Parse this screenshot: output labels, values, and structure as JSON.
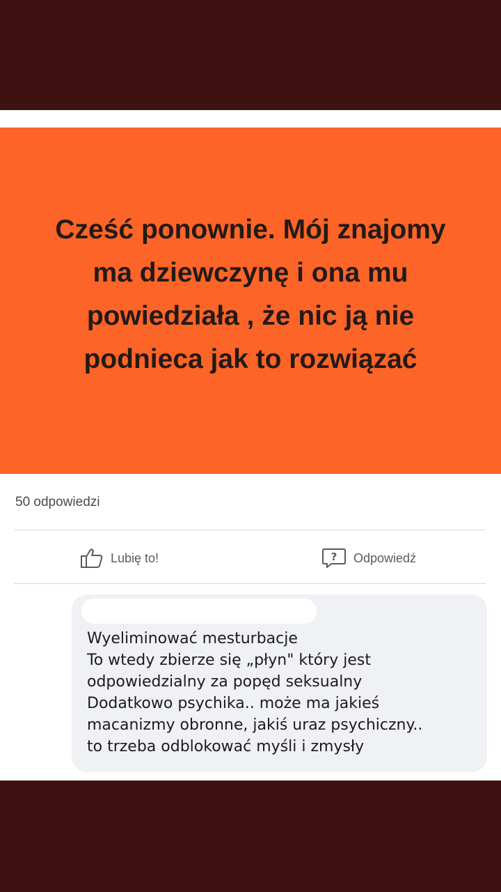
{
  "question": {
    "text": "Cześć ponownie. Mój znajomy ma dziewczynę i ona mu powiedziała , że nic ją nie podnieca jak to rozwiązać",
    "background": "#fd6427"
  },
  "answers_count": "50 odpowiedzi",
  "actions": {
    "like_label": "Lubię to!",
    "reply_label": "Odpowiedź",
    "like_icon": "thumbs-up-icon",
    "reply_icon": "question-bubble-icon"
  },
  "comment": {
    "lines": [
      "Wyeliminować mesturbacje",
      "To wtedy zbierze się „płyn\" który jest",
      "odpowiedzialny za popęd seksualny",
      "Dodatkowo psychika.. może ma jakieś",
      "macanizmy obronne, jakiś uraz psychiczny..",
      "to trzeba odblokować myśli i zmysły"
    ]
  }
}
